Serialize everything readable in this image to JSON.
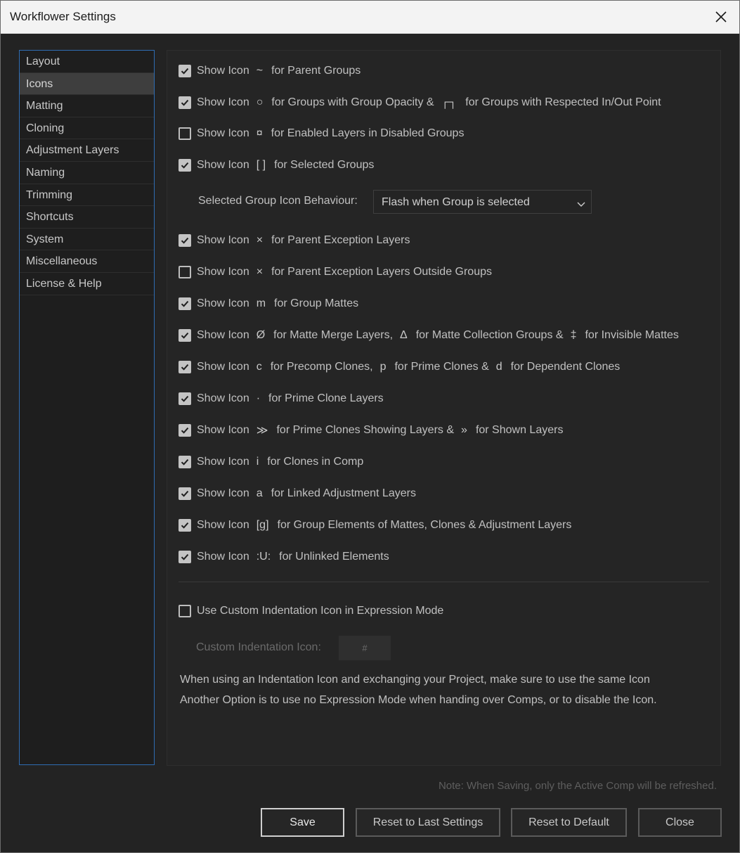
{
  "window": {
    "title": "Workflower Settings"
  },
  "sidebar": {
    "items": [
      {
        "label": "Layout",
        "active": false
      },
      {
        "label": "Icons",
        "active": true
      },
      {
        "label": "Matting",
        "active": false
      },
      {
        "label": "Cloning",
        "active": false
      },
      {
        "label": "Adjustment Layers",
        "active": false
      },
      {
        "label": "Naming",
        "active": false
      },
      {
        "label": "Trimming",
        "active": false
      },
      {
        "label": "Shortcuts",
        "active": false
      },
      {
        "label": "System",
        "active": false
      },
      {
        "label": "Miscellaneous",
        "active": false
      },
      {
        "label": "License & Help",
        "active": false
      }
    ]
  },
  "options": [
    {
      "checked": true,
      "parts": [
        "Show Icon",
        "~",
        "for Parent Groups"
      ]
    },
    {
      "checked": true,
      "parts": [
        "Show Icon",
        "○",
        "for Groups with Group Opacity &",
        "┌┐",
        "for Groups with Respected In/Out Point"
      ]
    },
    {
      "checked": false,
      "parts": [
        "Show Icon",
        "¤",
        "for Enabled Layers in Disabled Groups"
      ]
    },
    {
      "checked": true,
      "parts": [
        "Show Icon",
        "[ ]",
        "for Selected Groups"
      ]
    },
    {
      "checked": true,
      "parts": [
        "Show Icon",
        "×",
        "for Parent Exception Layers"
      ]
    },
    {
      "checked": false,
      "parts": [
        "Show Icon",
        "×",
        "for Parent Exception Layers Outside Groups"
      ]
    },
    {
      "checked": true,
      "parts": [
        "Show Icon",
        "m",
        "for Group Mattes"
      ]
    },
    {
      "checked": true,
      "parts": [
        "Show Icon",
        "Ø",
        "for Matte Merge Layers,",
        "Δ",
        "for Matte Collection Groups &",
        "‡",
        "for Invisible Mattes"
      ]
    },
    {
      "checked": true,
      "parts": [
        "Show Icon",
        "c",
        "for Precomp Clones,",
        "p",
        "for Prime Clones &",
        "d",
        "for Dependent Clones"
      ]
    },
    {
      "checked": true,
      "parts": [
        "Show Icon",
        "·",
        "for Prime Clone Layers"
      ]
    },
    {
      "checked": true,
      "parts": [
        "Show Icon",
        "≫",
        "for Prime Clones Showing Layers &",
        "»",
        "for Shown Layers"
      ]
    },
    {
      "checked": true,
      "parts": [
        "Show Icon",
        "i",
        "for Clones in Comp"
      ]
    },
    {
      "checked": true,
      "parts": [
        "Show Icon",
        "a",
        "for Linked Adjustment Layers"
      ]
    },
    {
      "checked": true,
      "parts": [
        "Show Icon",
        "[g]",
        "for Group Elements of Mattes, Clones & Adjustment Layers"
      ]
    },
    {
      "checked": true,
      "parts": [
        "Show Icon",
        ":U:",
        "for Unlinked Elements"
      ]
    }
  ],
  "behaviour": {
    "label": "Selected Group Icon Behaviour:",
    "selected": "Flash when Group is selected"
  },
  "custom_indent": {
    "checkbox_label": "Use Custom Indentation Icon in Expression Mode",
    "checked": false,
    "field_label": "Custom Indentation Icon:",
    "field_value": "#"
  },
  "info": {
    "line1": "When using an Indentation Icon and exchanging your Project, make sure to use the same Icon",
    "line2": "Another Option is to use no Expression Mode when handing over Comps, or to disable the Icon."
  },
  "note": "Note: When Saving, only the Active Comp will be refreshed.",
  "buttons": {
    "save": "Save",
    "reset_last": "Reset to Last Settings",
    "reset_default": "Reset to Default",
    "close": "Close"
  }
}
